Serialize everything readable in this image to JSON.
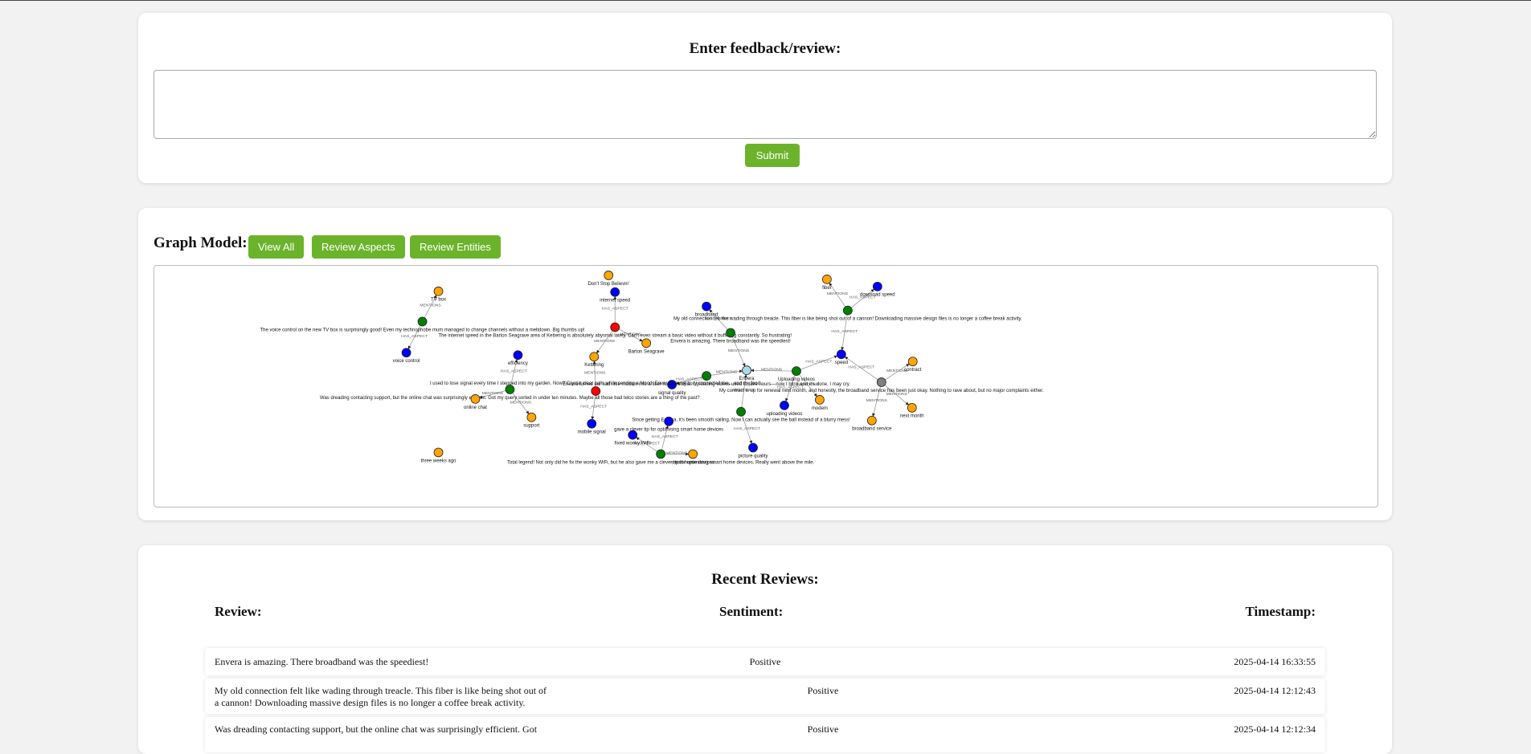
{
  "feedback": {
    "title": "Enter feedback/review:",
    "textarea_value": "",
    "submit_label": "Submit"
  },
  "graph": {
    "label": "Graph Model:",
    "buttons": {
      "view_all": "View All",
      "review_aspects": "Review Aspects",
      "review_entities": "Review Entities"
    },
    "legend_colors": {
      "review": "#008000",
      "aspect": "#0000ff",
      "entity": "#ffa500",
      "negative_review": "#ff0000",
      "neutral_review": "#808080",
      "brand": "#add8e6"
    },
    "nodes": [
      {
        "id": "n1",
        "kind": "entity",
        "label": "Don't Stop Believin'"
      },
      {
        "id": "n2",
        "kind": "entity",
        "label": "TV box"
      },
      {
        "id": "n3",
        "kind": "review",
        "label": "The voice control on the new TV box is surprisingly good! Even my technophobe mum managed to change channels without a meltdown. Big thumbs up!"
      },
      {
        "id": "n4",
        "kind": "aspect",
        "label": "voice control"
      },
      {
        "id": "n5",
        "kind": "aspect",
        "label": "internet speed"
      },
      {
        "id": "n6",
        "kind": "negative_review",
        "label": "The internet speed in the Barton Seagrave area of Kettering is absolutely abysmal lately. Can't even stream a basic video without it buffering constantly. So frustrating!"
      },
      {
        "id": "n7",
        "kind": "entity",
        "label": "Barton Seagrave"
      },
      {
        "id": "n8",
        "kind": "entity",
        "label": "Kettering"
      },
      {
        "id": "n9",
        "kind": "aspect",
        "label": "broadband"
      },
      {
        "id": "n10",
        "kind": "review",
        "label": "Envera is amazing. There broadband was the speediest!"
      },
      {
        "id": "n11",
        "kind": "entity",
        "label": "fiber"
      },
      {
        "id": "n12",
        "kind": "aspect",
        "label": "download speed"
      },
      {
        "id": "n13",
        "kind": "review",
        "label": "My old connection felt like wading through treacle. This fiber is like being shot out of a cannon! Downloading massive design files is no longer a coffee break activity."
      },
      {
        "id": "n14",
        "kind": "aspect",
        "label": "speed"
      },
      {
        "id": "n15",
        "kind": "aspect",
        "label": "efficiency"
      },
      {
        "id": "n16",
        "kind": "review",
        "label": "Was dreading contacting support, but the online chat was surprisingly efficient. Got my query sorted in under ten minutes. Maybe all those bad telco stories are a thing of the past?"
      },
      {
        "id": "n17",
        "kind": "entity",
        "label": "online chat"
      },
      {
        "id": "n18",
        "kind": "entity",
        "label": "support"
      },
      {
        "id": "n19",
        "kind": "negative_review",
        "label": "I used to lose signal every time I stepped into my garden. Now? Crystal clear calls while sending a Mood. Envera, you've truly connected me... and my food."
      },
      {
        "id": "n20",
        "kind": "aspect",
        "label": "mobile signal"
      },
      {
        "id": "n21",
        "kind": "aspect",
        "label": "signal quality"
      },
      {
        "id": "n22",
        "kind": "review",
        "label": "Envera turned our sad little modem into a fiber-fueled utopia. Uploading videos used to take hours—now I blink and it's done. I may cry."
      },
      {
        "id": "n23",
        "kind": "brand",
        "label": "Envera"
      },
      {
        "id": "n24",
        "kind": "review",
        "label": "Uploading videos"
      },
      {
        "id": "n25",
        "kind": "aspect",
        "label": "uploading videos"
      },
      {
        "id": "n26",
        "kind": "entity",
        "label": "modem"
      },
      {
        "id": "n27",
        "kind": "entity",
        "label": "contract"
      },
      {
        "id": "n28",
        "kind": "neutral_review",
        "label": "My contract is up for renewal next month, and honestly, the broadband service has been just okay. Nothing to rave about, but no major complaints either."
      },
      {
        "id": "n29",
        "kind": "entity",
        "label": "broadband service"
      },
      {
        "id": "n30",
        "kind": "entity",
        "label": "next month"
      },
      {
        "id": "n31",
        "kind": "review",
        "label": "Since getting Envera, it's been smooth sailing. Now I can actually see the ball instead of a blurry mess!"
      },
      {
        "id": "n32",
        "kind": "aspect",
        "label": "picture quality"
      },
      {
        "id": "n33",
        "kind": "aspect",
        "label": "gave a clever tip for optimising smart home devices"
      },
      {
        "id": "n34",
        "kind": "aspect",
        "label": "fixed wonky WiFi"
      },
      {
        "id": "n35",
        "kind": "review",
        "label": "Total legend! Not only did he fix the wonky WiFi, but he also gave me a clever tip for optimising smart home devices. Really went above the mile."
      },
      {
        "id": "n36",
        "kind": "entity",
        "label": "smart home devices"
      },
      {
        "id": "n37",
        "kind": "entity",
        "label": "three weeks ago"
      }
    ],
    "edges": [
      {
        "from": "n3",
        "to": "n2",
        "label": "MENTIONS"
      },
      {
        "from": "n3",
        "to": "n4",
        "label": "HAS_ASPECT"
      },
      {
        "from": "n6",
        "to": "n5",
        "label": "HAS_ASPECT"
      },
      {
        "from": "n6",
        "to": "n7",
        "label": "MENTIONS"
      },
      {
        "from": "n6",
        "to": "n8",
        "label": "MENTIONS"
      },
      {
        "from": "n10",
        "to": "n9",
        "label": "HAS_ASPECT"
      },
      {
        "from": "n10",
        "to": "n23",
        "label": "MENTIONS"
      },
      {
        "from": "n13",
        "to": "n11",
        "label": "MENTIONS"
      },
      {
        "from": "n13",
        "to": "n12",
        "label": "HAS_ASPECT"
      },
      {
        "from": "n13",
        "to": "n14",
        "label": "HAS_ASPECT"
      },
      {
        "from": "n16",
        "to": "n15",
        "label": "HAS_ASPECT"
      },
      {
        "from": "n16",
        "to": "n17",
        "label": "MENTIONS"
      },
      {
        "from": "n16",
        "to": "n18",
        "label": "MENTIONS"
      },
      {
        "from": "n19",
        "to": "n8",
        "label": "MENTIONS"
      },
      {
        "from": "n19",
        "to": "n20",
        "label": "HAS_ASPECT"
      },
      {
        "from": "n22",
        "to": "n21",
        "label": "HAS_ASPECT"
      },
      {
        "from": "n22",
        "to": "n23",
        "label": "MENTIONS"
      },
      {
        "from": "n24",
        "to": "n23",
        "label": "MENTIONS"
      },
      {
        "from": "n24",
        "to": "n14",
        "label": "HAS_ASPECT"
      },
      {
        "from": "n24",
        "to": "n25",
        "label": "HAS_ASPECT"
      },
      {
        "from": "n24",
        "to": "n26",
        "label": "MENTIONS"
      },
      {
        "from": "n28",
        "to": "n14",
        "label": "HAS_ASPECT"
      },
      {
        "from": "n28",
        "to": "n27",
        "label": "MENTIONS"
      },
      {
        "from": "n28",
        "to": "n29",
        "label": "MENTIONS"
      },
      {
        "from": "n28",
        "to": "n30",
        "label": "MENTIONS"
      },
      {
        "from": "n31",
        "to": "n23",
        "label": "MENTIONS"
      },
      {
        "from": "n31",
        "to": "n32",
        "label": "HAS_ASPECT"
      },
      {
        "from": "n35",
        "to": "n33",
        "label": "HAS_ASPECT"
      },
      {
        "from": "n35",
        "to": "n34",
        "label": "HAS_ASPECT"
      },
      {
        "from": "n35",
        "to": "n36",
        "label": "MENTIONS"
      }
    ]
  },
  "reviews": {
    "title": "Recent Reviews:",
    "columns": {
      "review": "Review:",
      "sentiment": "Sentiment:",
      "timestamp": "Timestamp:"
    },
    "rows": [
      {
        "text": "Envera is amazing. There broadband was the speediest!",
        "sentiment": "Positive",
        "timestamp": "2025-04-14 16:33:55"
      },
      {
        "text": "My old connection felt like wading through treacle. This fiber is like being shot out of a cannon! Downloading massive design files is no longer a coffee break activity.",
        "sentiment": "Positive",
        "timestamp": "2025-04-14 12:12:43"
      },
      {
        "text": "Was dreading contacting support, but the online chat was surprisingly efficient. Got",
        "sentiment": "Positive",
        "timestamp": "2025-04-14 12:12:34"
      }
    ]
  }
}
